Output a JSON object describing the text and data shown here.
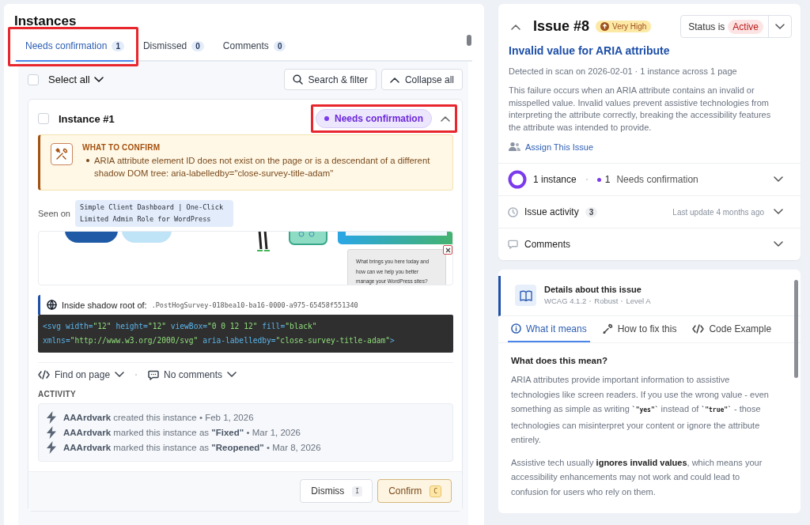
{
  "instances_panel": {
    "title": "Instances",
    "tabs": [
      {
        "label": "Needs confirmation",
        "count": "1",
        "selected": true,
        "highlighted": true
      },
      {
        "label": "Dismissed",
        "count": "0",
        "selected": false,
        "highlighted": false
      },
      {
        "label": "Comments",
        "count": "0",
        "selected": false,
        "highlighted": false
      }
    ],
    "select_all": {
      "label": "Select all",
      "checked": false
    },
    "buttons": [
      {
        "label": "Search & filter"
      },
      {
        "label": "Collapse all"
      }
    ],
    "instance": {
      "title": "Instance #1",
      "checked": false,
      "expanded": true,
      "status": "Needs confirmation",
      "status_highlighted": true,
      "confirm_box": {
        "heading": "WHAT TO CONFIRM",
        "items": [
          "ARIA attribute element ID does not exist on the page or is a descendant of a different shadow DOM tree: aria-labelledby=\"close-survey-title-adam\""
        ]
      },
      "seen_on_label": "Seen on",
      "seen_on_page": "Simple Client Dashboard | One-Click Limited Admin Role for WordPress",
      "preview": {
        "survey_text": "What brings you here today and how can we help you better manage your WordPress sites?"
      },
      "shadow_root": {
        "label": "Inside shadow root of:",
        "selector": ".PostHogSurvey-018bea10-ba16-0000-a975-65458f551340"
      },
      "code_lines": [
        [
          {
            "kind": "tag",
            "text": "<svg"
          },
          {
            "kind": "attr",
            "text": " width="
          },
          {
            "kind": "value",
            "text": "\"12\""
          },
          {
            "kind": "attr",
            "text": " height="
          },
          {
            "kind": "value",
            "text": "\"12\""
          },
          {
            "kind": "attr",
            "text": " viewBox="
          },
          {
            "kind": "value",
            "text": "\"0 0 12 12\""
          },
          {
            "kind": "attr",
            "text": " fill="
          },
          {
            "kind": "value",
            "text": "\"black\""
          }
        ],
        [
          {
            "kind": "attr",
            "text": "xmlns="
          },
          {
            "kind": "value",
            "text": "\"http://www.w3.org/2000/svg\""
          },
          {
            "kind": "attr",
            "text": " aria-labelledby="
          },
          {
            "kind": "value",
            "text": "\"close-survey-title-adam\""
          },
          {
            "kind": "tag",
            "text": ">"
          }
        ]
      ],
      "find_on_page": "Find on page",
      "comments": "No comments",
      "activity_heading": "ACTIVITY",
      "activity": [
        "**AAArdvark** created this instance • Feb 1, 2026",
        "**AAArdvark** marked this instance as **\"Fixed\"** • Mar 1, 2026",
        "**AAArdvark** marked this instance as **\"Reopened\"** • Mar 8, 2026"
      ],
      "actions": [
        {
          "label": "Dismiss",
          "key": "I",
          "kind": "secondary"
        },
        {
          "label": "Confirm",
          "key": "C",
          "kind": "primary"
        }
      ]
    }
  },
  "issue": {
    "expanded": true,
    "number": "Issue #8",
    "severity": "Very High",
    "status_label": "Status is",
    "status": "Active",
    "title": "Invalid value for ARIA attribute",
    "meta": "Detected in scan on 2026-02-01 · 1 instance across 1 page",
    "description": "This failure occurs when an ARIA attribute contains an invalid or misspelled value. Invalid values prevent assistive technologies from interpreting the attribute correctly, breaking the accessibility features the attribute was intended to provide.",
    "assign": "Assign This Issue",
    "instances": {
      "count_text": "1 instance",
      "needs_count": "1",
      "needs_label": "Needs confirmation"
    },
    "activity": {
      "label": "Issue activity",
      "count": "3",
      "last_update": "Last update 4 months ago"
    },
    "comments": {
      "label": "Comments"
    }
  },
  "details": {
    "title": "Details about this issue",
    "meta": [
      "WCAG 4.1.2",
      "Robust",
      "Level A"
    ],
    "tabs": [
      {
        "label": "What it means",
        "selected": true
      },
      {
        "label": "How to fix this",
        "selected": false
      },
      {
        "label": "Code Example",
        "selected": false
      }
    ],
    "heading": "What does this mean?",
    "paragraphs": [
      [
        {
          "kind": "text",
          "text": "ARIA attributes provide important information to assistive technologies like screen readers. If you use the wrong value - even something as simple as writing "
        },
        {
          "kind": "code",
          "text": "`\"yes\"`"
        },
        {
          "kind": "text",
          "text": " instead of "
        },
        {
          "kind": "code",
          "text": "`\"true\"`"
        },
        {
          "kind": "text",
          "text": " - those technologies can misinterpret your content or ignore the attribute entirely."
        }
      ],
      [
        {
          "kind": "text",
          "text": "Assistive tech usually **ignores invalid values**, which means your accessibility enhancements may not work and could lead to confusion for users who rely on them."
        }
      ]
    ]
  }
}
